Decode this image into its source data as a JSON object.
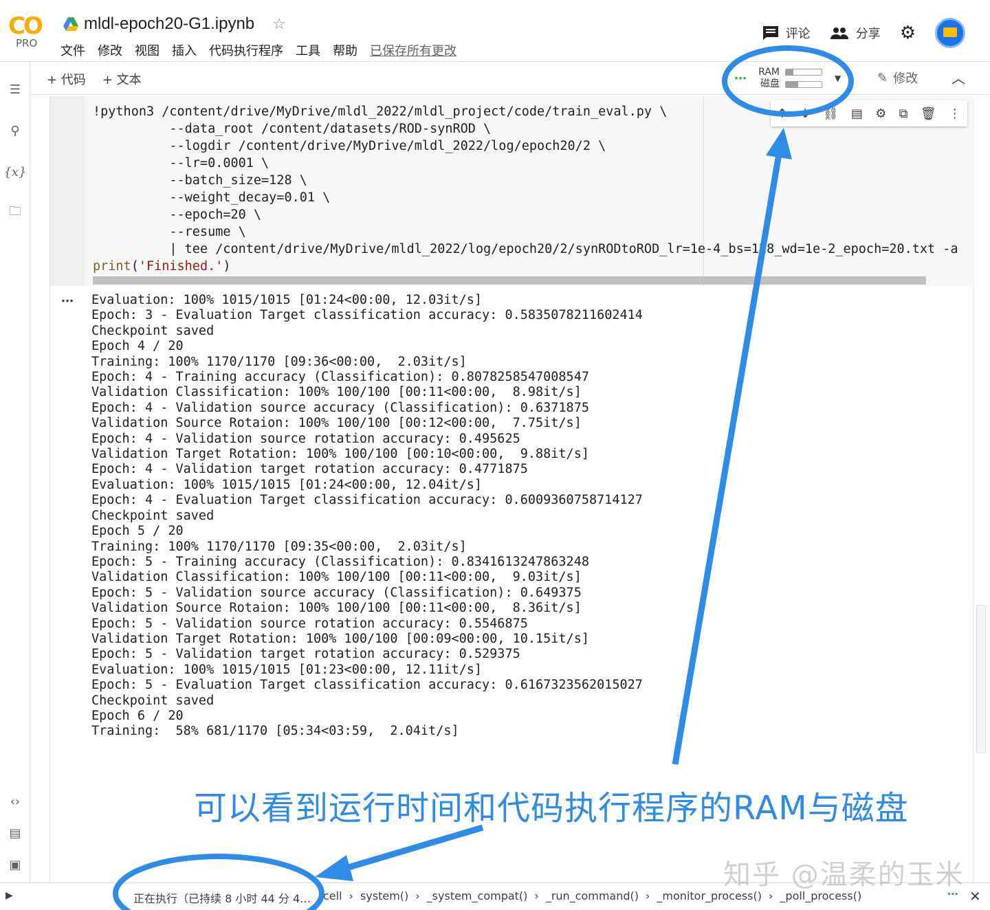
{
  "header": {
    "logo_text": "CO",
    "logo_sub": "PRO",
    "notebook_title": "mldl-epoch20-G1.ipynb",
    "menu": [
      "文件",
      "修改",
      "视图",
      "插入",
      "代码执行程序",
      "工具",
      "帮助"
    ],
    "saved_status": "已保存所有更改",
    "comment_label": "评论",
    "share_label": "分享"
  },
  "toolbar": {
    "add_code": "+ 代码",
    "add_text": "+ 文本",
    "ram_label": "RAM",
    "disk_label": "磁盘",
    "ram_fill": 0.22,
    "disk_fill": 0.35,
    "edit_label": "修改"
  },
  "code_lines": [
    "!python3 /content/drive/MyDrive/mldl_2022/mldl_project/code/train_eval.py \\",
    "          --data_root /content/datasets/ROD-synROD \\",
    "          --logdir /content/drive/MyDrive/mldl_2022/log/epoch20/2 \\",
    "          --lr=0.0001 \\",
    "          --batch_size=128 \\",
    "          --weight_decay=0.01 \\",
    "          --epoch=20 \\",
    "          --resume \\",
    "          | tee /content/drive/MyDrive/mldl_2022/log/epoch20/2/synRODtoROD_lr=1e-4_bs=128_wd=1e-2_epoch=20.txt -a",
    "print('Finished.')"
  ],
  "output_lines": [
    "Evaluation: 100% 1015/1015 [01:24<00:00, 12.03it/s]",
    "Epoch: 3 - Evaluation Target classification accuracy: 0.5835078211602414",
    "Checkpoint saved",
    "Epoch 4 / 20",
    "Training: 100% 1170/1170 [09:36<00:00,  2.03it/s]",
    "Epoch: 4 - Training accuracy (Classification): 0.8078258547008547",
    "Validation Classification: 100% 100/100 [00:11<00:00,  8.98it/s]",
    "Epoch: 4 - Validation source accuracy (Classification): 0.6371875",
    "Validation Source Rotaion: 100% 100/100 [00:12<00:00,  7.75it/s]",
    "Epoch: 4 - Validation source rotation accuracy: 0.495625",
    "Validation Target Rotation: 100% 100/100 [00:10<00:00,  9.88it/s]",
    "Epoch: 4 - Validation target rotation accuracy: 0.4771875",
    "Evaluation: 100% 1015/1015 [01:24<00:00, 12.04it/s]",
    "Epoch: 4 - Evaluation Target classification accuracy: 0.6009360758714127",
    "Checkpoint saved",
    "Epoch 5 / 20",
    "Training: 100% 1170/1170 [09:35<00:00,  2.03it/s]",
    "Epoch: 5 - Training accuracy (Classification): 0.8341613247863248",
    "Validation Classification: 100% 100/100 [00:11<00:00,  9.03it/s]",
    "Epoch: 5 - Validation source accuracy (Classification): 0.649375",
    "Validation Source Rotaion: 100% 100/100 [00:11<00:00,  8.36it/s]",
    "Epoch: 5 - Validation source rotation accuracy: 0.5546875",
    "Validation Target Rotation: 100% 100/100 [00:09<00:00, 10.15it/s]",
    "Epoch: 5 - Validation target rotation accuracy: 0.529375",
    "Evaluation: 100% 1015/1015 [01:23<00:00, 12.11it/s]",
    "Epoch: 5 - Evaluation Target classification accuracy: 0.6167323562015027",
    "Checkpoint saved",
    "Epoch 6 / 20",
    "Training:  58% 681/1170 [05:34<03:59,  2.04it/s]"
  ],
  "status": {
    "running": "正在执行（已持续 8 小时 44 分 4…",
    "stack": [
      "cell",
      "system()",
      "_system_compat()",
      "_run_command()",
      "_monitor_process()",
      "_poll_process()"
    ]
  },
  "annotation": "可以看到运行时间和代码执行程序的RAM与磁盘",
  "watermark": "知乎 @温柔的玉米",
  "colors": {
    "annotation_blue": "#2f8be8",
    "logo_orange": "#f9ab00",
    "status_green": "#34a853"
  }
}
